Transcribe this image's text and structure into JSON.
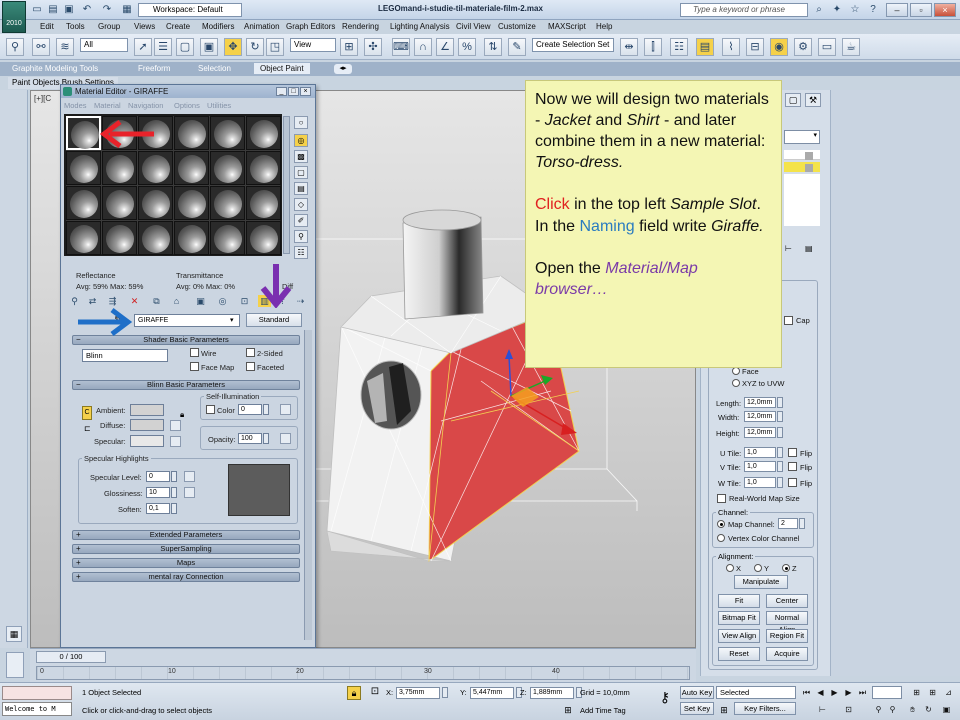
{
  "app": {
    "logo_text": "2010",
    "workspace": "Workspace: Default",
    "file_title": "LEGOmand-i-studie-til-materiale-film-2.max",
    "search_placeholder": "Type a keyword or phrase"
  },
  "menu": [
    "Edit",
    "Tools",
    "Group",
    "Views",
    "Create",
    "Modifiers",
    "Animation",
    "Graph Editors",
    "Rendering",
    "Lighting Analysis",
    "Civil View",
    "Customize",
    "MAXScript",
    "Help"
  ],
  "toolbar": {
    "selection_filter": "All",
    "ref_coord": "View",
    "named_selection": "Create Selection Set"
  },
  "ribbon": {
    "tabs": [
      "Graphite Modeling Tools",
      "Freeform",
      "Selection",
      "Object Paint"
    ],
    "active_tab": "Object Paint",
    "subtabs": "Paint Objects   Brush Settings"
  },
  "viewport": {
    "label": "[+][C"
  },
  "material_editor": {
    "title": "Material Editor - GIRAFFE",
    "menu": [
      "Modes",
      "Material",
      "Navigation",
      "Options",
      "Utilities"
    ],
    "reflectance_label": "Reflectance",
    "reflectance_value": "Avg: 59% Max: 59%",
    "transmittance_label": "Transmittance",
    "transmittance_value": "Avg:   0% Max:   0%",
    "diffuse_short": "Diff",
    "name": "GIRAFFE",
    "type_button": "Standard",
    "rollouts": {
      "shader_basic": "Shader Basic Parameters",
      "blinn_basic": "Blinn Basic Parameters",
      "extended": "Extended Parameters",
      "supersampling": "SuperSampling",
      "maps": "Maps",
      "mental_ray": "mental ray Connection"
    },
    "shader": {
      "type": "Blinn",
      "wire": "Wire",
      "two_sided": "2-Sided",
      "face_map": "Face Map",
      "faceted": "Faceted"
    },
    "blinn": {
      "self_illum": "Self-Illumination",
      "color_label": "Color",
      "color_value": "0",
      "ambient": "Ambient:",
      "diffuse": "Diffuse:",
      "specular": "Specular:",
      "opacity_label": "Opacity:",
      "opacity_value": "100",
      "lock_letter": "C"
    },
    "specular": {
      "group": "Specular Highlights",
      "level_label": "Specular Level:",
      "level_value": "0",
      "gloss_label": "Glossiness:",
      "gloss_value": "10",
      "soften_label": "Soften:",
      "soften_value": "0,1"
    }
  },
  "note": {
    "p1_before": "Now we will design two materials - ",
    "p1_jacket": "Jacket",
    "p1_and": " and ",
    "p1_shirt": "Shirt",
    "p1_after": " - and later combine them in a new material: ",
    "p1_torso": "Torso-dress.",
    "p2_click": "Click",
    "p2_mid": " in the top left ",
    "p2_slot": "Sample Slot",
    "p2_mid2": ". In the ",
    "p2_naming": "Naming",
    "p2_mid3": " field write ",
    "p2_giraffe": "Giraffe.",
    "p3_before": "Open the ",
    "p3_browser": "Material/Map browser…"
  },
  "command_panel": {
    "cap": "Cap",
    "face": "Face",
    "xyz_to_uvw": "XYZ to UVW",
    "length_label": "Length:",
    "length_value": "12,0mm",
    "width_label": "Width:",
    "width_value": "12,0mm",
    "height_label": "Height:",
    "height_value": "12,0mm",
    "utile_label": "U Tile:",
    "utile_value": "1,0",
    "vtile_label": "V Tile:",
    "vtile_value": "1,0",
    "wtile_label": "W Tile:",
    "wtile_value": "1,0",
    "flip": "Flip",
    "real_world": "Real-World Map Size",
    "channel_group": "Channel:",
    "map_channel_label": "Map Channel:",
    "map_channel_value": "2",
    "vertex_color": "Vertex Color Channel",
    "alignment_group": "Alignment:",
    "axis_x": "X",
    "axis_y": "Y",
    "axis_z": "Z",
    "manipulate": "Manipulate",
    "fit": "Fit",
    "center": "Center",
    "bitmap_fit": "Bitmap Fit",
    "normal_align": "Normal Align",
    "view_align": "View Align",
    "region_fit": "Region Fit",
    "reset": "Reset",
    "acquire": "Acquire"
  },
  "timeline": {
    "slider": "0 / 100",
    "ticks": [
      "0",
      "10",
      "20",
      "30",
      "40"
    ]
  },
  "status": {
    "maxscript_welcome": "Welcome to M",
    "selected": "1 Object Selected",
    "prompt": "Click or click-and-drag to select objects",
    "x_label": "X:",
    "x_value": "3,75mm",
    "y_label": "Y:",
    "y_value": "5,447mm",
    "z_label": "Z:",
    "z_value": "1,889mm",
    "grid": "Grid = 10,0mm",
    "add_time_tag": "Add Time Tag",
    "auto_key": "Auto Key",
    "set_key": "Set Key",
    "selected_combo": "Selected",
    "key_filters": "Key Filters..."
  }
}
